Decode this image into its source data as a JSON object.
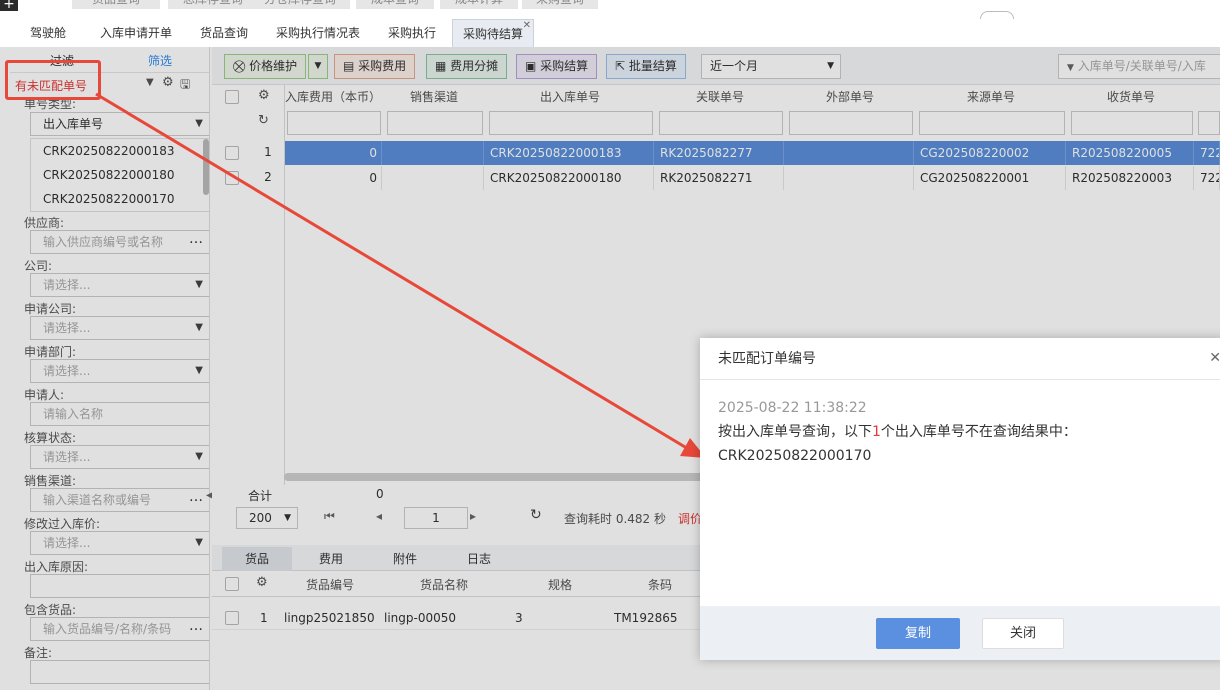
{
  "topmenu": [
    "货品查询",
    "总库存查询",
    "分仓库存查询",
    "成本查询",
    "成本计算",
    "采购查询"
  ],
  "tabs": [
    "驾驶舱",
    "入库申请开单",
    "货品查询",
    "采购执行情况表",
    "采购执行",
    "采购待结算"
  ],
  "active_tab": "采购待结算",
  "sidebar": {
    "tab_filter": "过滤",
    "tab_screen": "筛选",
    "unmatched_link": "有未匹配单号",
    "doc_type_label": "单号类型:",
    "doc_type_value": "出入库单号",
    "doc_numbers": [
      "CRK20250822000183",
      "CRK20250822000180",
      "CRK20250822000170"
    ],
    "fields": [
      {
        "label": "供应商:",
        "placeholder": "输入供应商编号或名称",
        "kind": "dots"
      },
      {
        "label": "公司:",
        "placeholder": "请选择...",
        "kind": "select"
      },
      {
        "label": "申请公司:",
        "placeholder": "请选择...",
        "kind": "select"
      },
      {
        "label": "申请部门:",
        "placeholder": "请选择...",
        "kind": "select"
      },
      {
        "label": "申请人:",
        "placeholder": "请输入名称",
        "kind": "text"
      },
      {
        "label": "核算状态:",
        "placeholder": "请选择...",
        "kind": "select"
      },
      {
        "label": "销售渠道:",
        "placeholder": "输入渠道名称或编号",
        "kind": "dots"
      },
      {
        "label": "修改过入库价:",
        "placeholder": "请选择...",
        "kind": "select"
      },
      {
        "label": "出入库原因:",
        "placeholder": "",
        "kind": "text"
      },
      {
        "label": "包含货品:",
        "placeholder": "输入货品编号/名称/条码",
        "kind": "dots"
      },
      {
        "label": "备注:",
        "placeholder": "",
        "kind": "text"
      }
    ]
  },
  "toolbar": {
    "price_btn": "价格维护",
    "purchase_fee_btn": "采购费用",
    "fee_alloc_btn": "费用分摊",
    "purchase_settle_btn": "采购结算",
    "batch_settle_btn": "批量结算",
    "period": "近一个月",
    "search_placeholder": "入库单号/关联单号/入库"
  },
  "grid": {
    "columns": [
      "入库费用（本币）",
      "销售渠道",
      "出入库单号",
      "关联单号",
      "外部单号",
      "来源单号",
      "收货单号"
    ],
    "rows": [
      {
        "n": "1",
        "fee": "0",
        "channel": "",
        "doc": "CRK20250822000183",
        "rel": "RK2025082277",
        "ext": "",
        "src": "CG202508220002",
        "recv": "R202508220005",
        "extra": "722"
      },
      {
        "n": "2",
        "fee": "0",
        "channel": "",
        "doc": "CRK20250822000180",
        "rel": "RK2025082271",
        "ext": "",
        "src": "CG202508220001",
        "recv": "R202508220003",
        "extra": "722"
      }
    ],
    "total_label": "合计",
    "total_value": "0",
    "page_size": "200",
    "page": "1",
    "query_time": "查询耗时 0.482 秒",
    "red_hint": "调价"
  },
  "bottom": {
    "tabs": [
      "货品",
      "费用",
      "附件",
      "日志"
    ],
    "columns": [
      "货品编号",
      "货品名称",
      "规格",
      "条码"
    ],
    "rows": [
      {
        "n": "1",
        "code": "lingp25021850",
        "name": "lingp-00050",
        "spec": "3",
        "barcode": "TM192865"
      }
    ]
  },
  "dialog": {
    "title": "未匹配订单编号",
    "timestamp": "2025-08-22 11:38:22",
    "msg_pre": "按出入库单号查询，以下",
    "msg_count": "1",
    "msg_post": "个出入库单号不在查询结果中：",
    "number": "CRK20250822000170",
    "copy_btn": "复制",
    "close_btn": "关闭"
  },
  "colors": {
    "accent": "#2d8cf0",
    "selected_row": "#5b8fdb",
    "annotation": "#e8483a",
    "copy_button": "#5b8fe0"
  }
}
